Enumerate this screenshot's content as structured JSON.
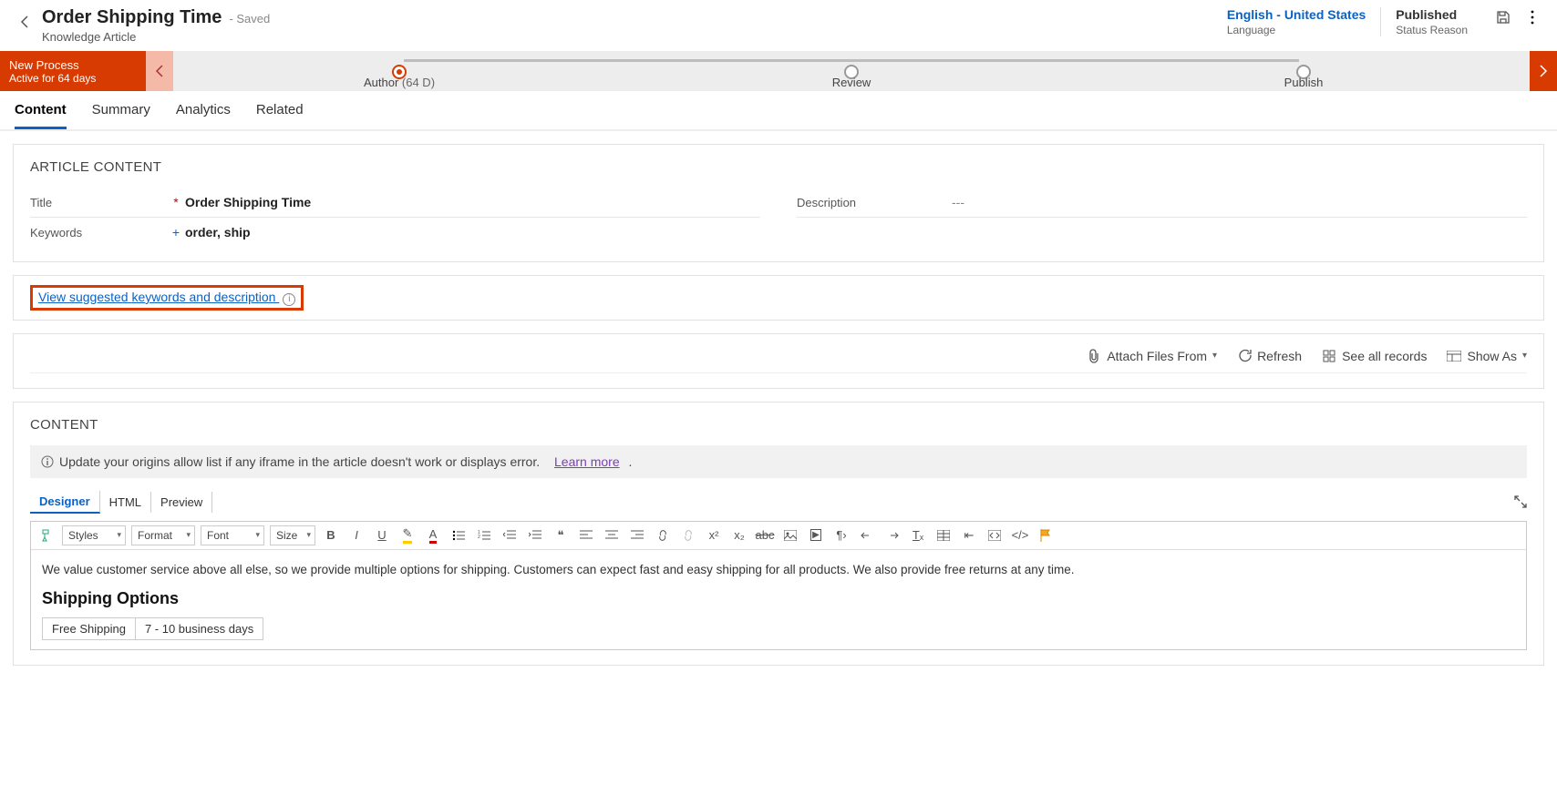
{
  "header": {
    "title": "Order Shipping Time",
    "saved_suffix": "- Saved",
    "subtitle": "Knowledge Article",
    "language_value": "English - United States",
    "language_label": "Language",
    "status_value": "Published",
    "status_label": "Status Reason"
  },
  "process": {
    "name": "New Process",
    "active_for": "Active for 64 days",
    "stages": [
      {
        "label": "Author",
        "duration": "(64 D)",
        "active": true
      },
      {
        "label": "Review",
        "duration": "",
        "active": false
      },
      {
        "label": "Publish",
        "duration": "",
        "active": false
      }
    ]
  },
  "tabs": [
    "Content",
    "Summary",
    "Analytics",
    "Related"
  ],
  "article": {
    "section_title": "ARTICLE CONTENT",
    "title_label": "Title",
    "title_value": "Order Shipping Time",
    "keywords_label": "Keywords",
    "keywords_value": "order, ship",
    "description_label": "Description",
    "description_value": "---"
  },
  "suggest_link": "View suggested keywords and description",
  "attach_toolbar": {
    "attach": "Attach Files From",
    "refresh": "Refresh",
    "see_all": "See all records",
    "show_as": "Show As"
  },
  "content_section": {
    "title": "CONTENT",
    "banner_text": "Update your origins allow list if any iframe in the article doesn't work or displays error.",
    "banner_link": "Learn more",
    "editor_tabs": [
      "Designer",
      "HTML",
      "Preview"
    ],
    "rte_selects": {
      "styles": "Styles",
      "format": "Format",
      "font": "Font",
      "size": "Size"
    },
    "body_para": "We value customer service above all else, so we provide multiple options for shipping. Customers can expect fast and easy shipping for all products. We also provide free returns at any time.",
    "body_h2": "Shipping Options",
    "table": [
      [
        "Free Shipping",
        "7 - 10 business days"
      ]
    ]
  }
}
